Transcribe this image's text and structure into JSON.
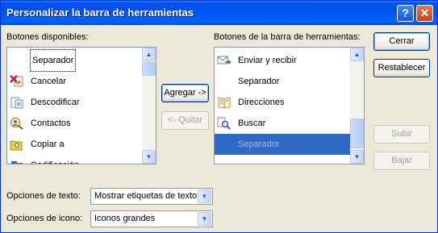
{
  "window": {
    "title": "Personalizar la barra de herramientas",
    "help_label": "?",
    "close_label": "✕"
  },
  "available": {
    "label": "Botones disponibles:",
    "items": [
      {
        "label": "Separador",
        "icon": "none"
      },
      {
        "label": "Cancelar",
        "icon": "cancel-icon"
      },
      {
        "label": "Descodificar",
        "icon": "decode-icon"
      },
      {
        "label": "Contactos",
        "icon": "contacts-icon"
      },
      {
        "label": "Copiar a",
        "icon": "copy-to-icon"
      },
      {
        "label": "Codificación",
        "icon": "encoding-icon"
      }
    ]
  },
  "toolbar": {
    "label": "Botones de la barra de herramientas:",
    "items": [
      {
        "label": "Enviar y recibir",
        "icon": "send-receive-icon"
      },
      {
        "label": "Separador",
        "icon": "none"
      },
      {
        "label": "Direcciones",
        "icon": "address-book-icon"
      },
      {
        "label": "Buscar",
        "icon": "find-icon"
      },
      {
        "label": "Separador",
        "icon": "none"
      }
    ]
  },
  "buttons": {
    "add": "Agregar ->",
    "remove": "<- Quitar",
    "close": "Cerrar",
    "reset": "Restablecer",
    "up": "Subir",
    "down": "Bajar"
  },
  "options": {
    "text_label": "Opciones de texto:",
    "text_value": "Mostrar etiquetas de texto",
    "icon_label": "Opciones de icono:",
    "icon_value": "Iconos grandes"
  },
  "scroll_glyphs": {
    "up": "▲",
    "down": "▼"
  }
}
